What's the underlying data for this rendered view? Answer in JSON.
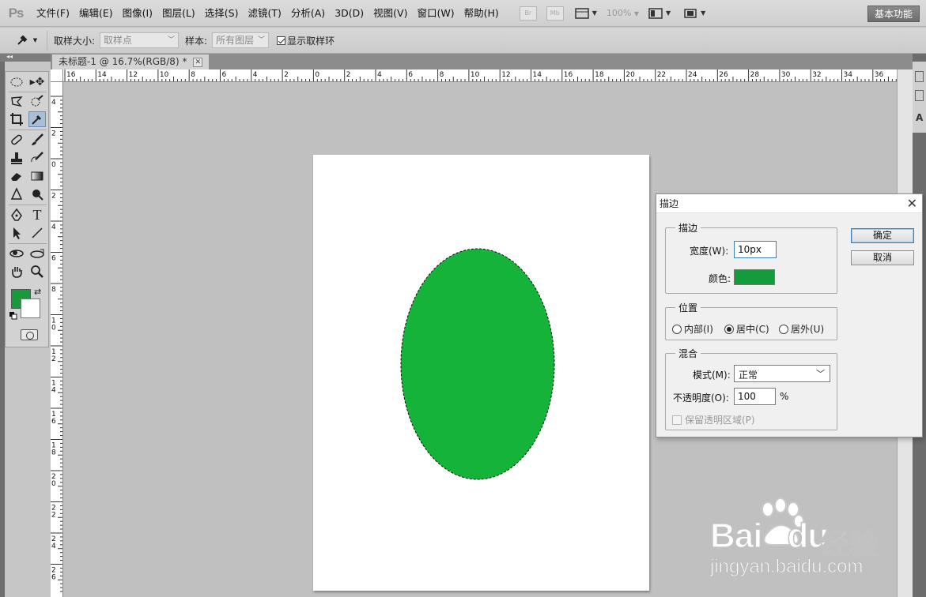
{
  "app": {
    "logo": "Ps",
    "workspace": "基本功能",
    "zoom": "100%"
  },
  "menu": [
    "文件(F)",
    "编辑(E)",
    "图像(I)",
    "图层(L)",
    "选择(S)",
    "滤镜(T)",
    "分析(A)",
    "3D(D)",
    "视图(V)",
    "窗口(W)",
    "帮助(H)"
  ],
  "menubar_buttons": {
    "bridge": "Br",
    "mini_bridge": "Mb"
  },
  "options": {
    "sample_size_label": "取样大小:",
    "sample_size_value": "取样点",
    "sample_label": "样本:",
    "sample_value": "所有图层",
    "show_ring_label": "显示取样环",
    "show_ring_checked": true
  },
  "document": {
    "tab_title": "未标题-1 @ 16.7%(RGB/8) *",
    "close_glyph": "✕"
  },
  "ruler_h_labels": [
    "16",
    "14",
    "12",
    "10",
    "8",
    "6",
    "4",
    "2",
    "0",
    "2",
    "4",
    "6",
    "8",
    "10",
    "12",
    "14",
    "16",
    "18",
    "20",
    "22",
    "24",
    "26",
    "28",
    "30",
    "32",
    "34",
    "36"
  ],
  "ruler_v_labels": [
    "4",
    "2",
    "0",
    "2",
    "4",
    "6",
    "8",
    "1 0",
    "1 2",
    "1 4",
    "1 6",
    "1 8",
    "2 0",
    "2 2",
    "2 4",
    "2 6"
  ],
  "colors": {
    "foreground": "#149c3c",
    "background": "#ffffff",
    "ellipse": "#16b33a"
  },
  "dialog": {
    "title": "描边",
    "close": "✕",
    "stroke_group": "描边",
    "width_label": "宽度(W):",
    "width_value": "10px",
    "color_label": "颜色:",
    "position_group": "位置",
    "position_options": [
      {
        "label": "内部(I)",
        "selected": false
      },
      {
        "label": "居中(C)",
        "selected": true
      },
      {
        "label": "居外(U)",
        "selected": false
      }
    ],
    "blend_group": "混合",
    "mode_label": "模式(M):",
    "mode_value": "正常",
    "opacity_label": "不透明度(O):",
    "opacity_value": "100",
    "opacity_unit": "%",
    "preserve_label": "保留透明区域(P)",
    "ok": "确定",
    "cancel": "取消"
  },
  "watermark": {
    "brand": "Bai",
    "brand2": "du",
    "cn": "经验",
    "url": "jingyan.baidu.com"
  }
}
